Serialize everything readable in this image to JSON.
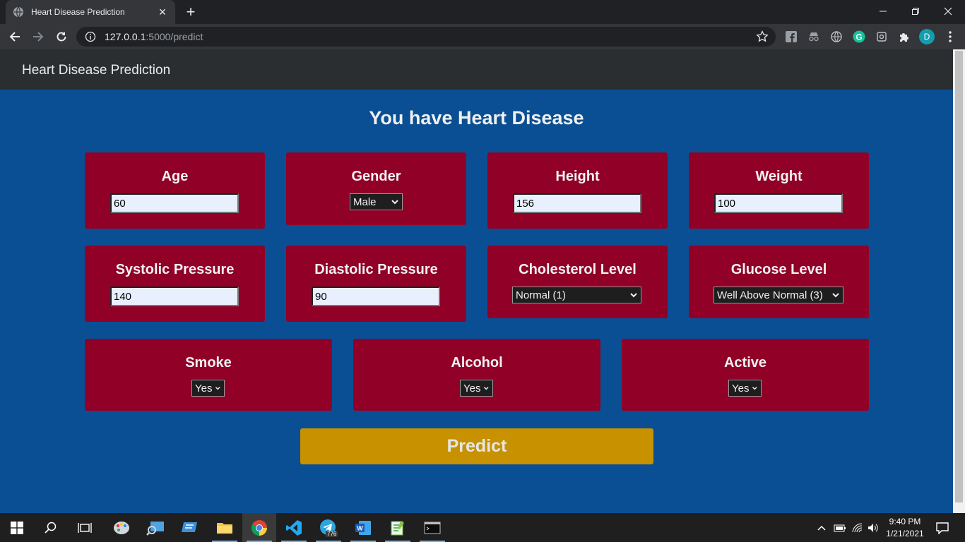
{
  "browser": {
    "tab_title": "Heart Disease Prediction",
    "url_host": "127.0.0.1",
    "url_rest": ":5000/predict",
    "profile_initial": "D"
  },
  "page": {
    "brand": "Heart Disease Prediction",
    "result": "You have Heart Disease",
    "fields": {
      "age": {
        "label": "Age",
        "value": "60"
      },
      "gender": {
        "label": "Gender",
        "value": "Male"
      },
      "height": {
        "label": "Height",
        "value": "156"
      },
      "weight": {
        "label": "Weight",
        "value": "100"
      },
      "systolic": {
        "label": "Systolic Pressure",
        "value": "140"
      },
      "diastolic": {
        "label": "Diastolic Pressure",
        "value": "90"
      },
      "cholesterol": {
        "label": "Cholesterol Level",
        "value": "Normal (1)"
      },
      "glucose": {
        "label": "Glucose Level",
        "value": "Well Above Normal (3)"
      },
      "smoke": {
        "label": "Smoke",
        "value": "Yes"
      },
      "alcohol": {
        "label": "Alcohol",
        "value": "Yes"
      },
      "active": {
        "label": "Active",
        "value": "Yes"
      }
    },
    "predict_label": "Predict"
  },
  "taskbar": {
    "telegram_badge": "776",
    "time": "9:40 PM",
    "date": "1/21/2021"
  },
  "colors": {
    "page_bg": "#0a4f94",
    "card_bg": "#900027",
    "button_bg": "#c79100",
    "navbar_bg": "#2b2e31"
  }
}
